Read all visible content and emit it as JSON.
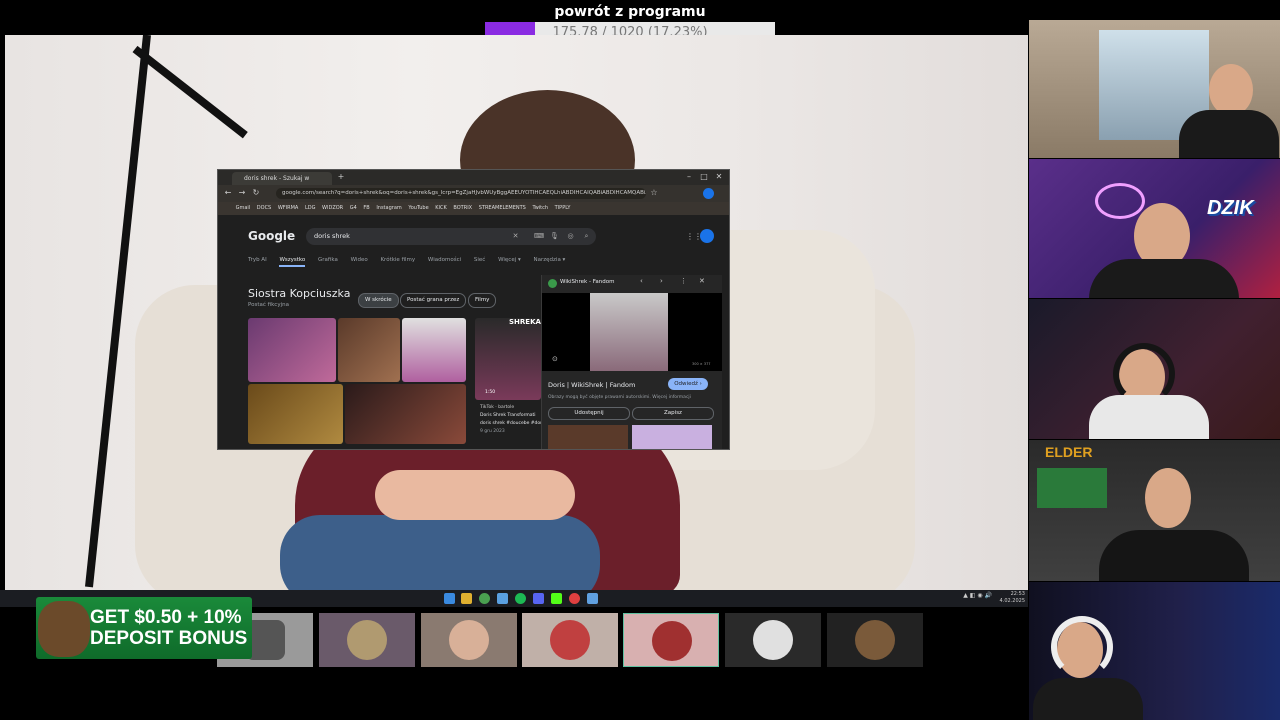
{
  "overlay": {
    "title": "powrót z programu",
    "progress_text": "175.78 / 1020 (17.23%)",
    "progress_fraction": 0.1723,
    "progress_color": "#8a2be2"
  },
  "browser": {
    "tab_title": "doris shrek - Szukaj w Google",
    "url": "google.com/search?q=doris+shrek&oq=doris+shrek&gs_lcrp=EgZjaHJvbWUyBggAEEUYOTIHCAEQLhiABDIHCAIQABiABDIHCAMQABiABDIHCA...",
    "bookmarks": [
      "Gmail",
      "DOCS",
      "WFIRMA",
      "LDG",
      "WIDZOR",
      "G4",
      "FB",
      "Instagram",
      "YouTube",
      "KICK",
      "BOTRIX",
      "STREAMELEMENTS",
      "Twitch",
      "TIPPLY"
    ],
    "search_query": "doris shrek",
    "logo": "Google",
    "tabs": [
      "Tryb AI",
      "Wszystko",
      "Grafika",
      "Wideo",
      "Krótkie filmy",
      "Wiadomości",
      "Sieć",
      "Więcej ▾",
      "Narzędzia ▾"
    ],
    "active_tab": "Wszystko",
    "kp_title": "Siostra Kopciuszka",
    "kp_subtitle": "Postać fikcyjna",
    "chips": [
      "W skrócie",
      "Postać grana przez",
      "Filmy"
    ],
    "shrek_label": "SHREKA",
    "tiktok": {
      "source": "TikTok · bartole",
      "title": "Doris Shrek Transformati",
      "tags": "doris shrek #doucebe #doris",
      "date": "9 gru 2023",
      "views": "1:50"
    },
    "side_panel": {
      "source": "WikiShrek - Fandom",
      "title": "Doris | WikiShrek | Fandom",
      "visit": "Odwiedź ›",
      "note": "Obrazy mogą być objęte prawami autorskimi. Więcej informacji",
      "share": "Udostępnij",
      "save": "Zapisz",
      "img_size": "300 × 377"
    }
  },
  "taskbar": {
    "clock_time": "22:53",
    "clock_date": "4.02.2025"
  },
  "ad": {
    "line1": "GET $0.50 + 10%",
    "line2": "DEPOSIT BONUS"
  },
  "webcams": {
    "cam2_label": "DZIK",
    "cam4_label": "ELDER"
  }
}
